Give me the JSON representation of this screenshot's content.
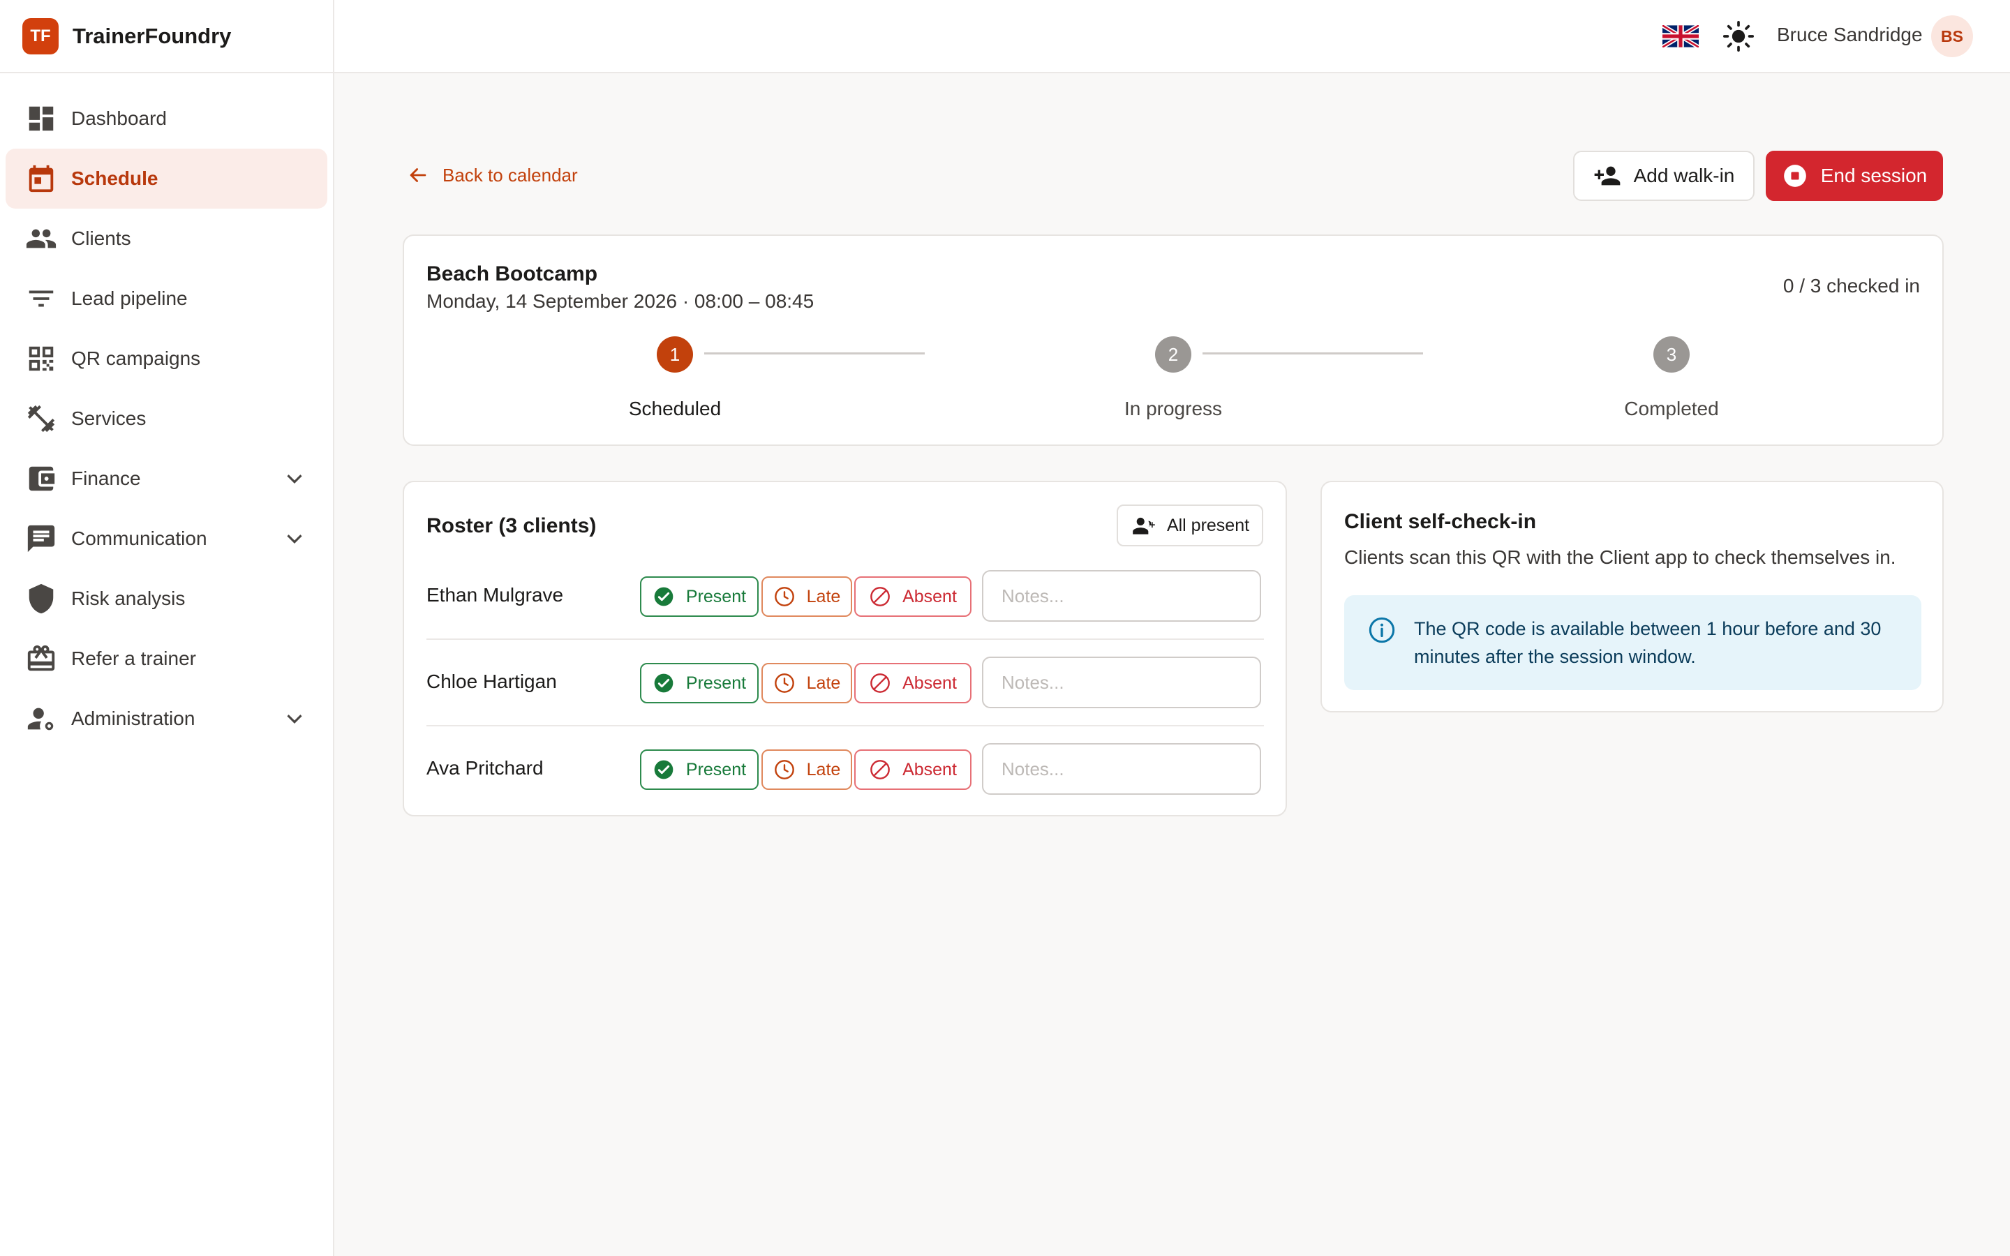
{
  "brand": {
    "logo_text": "TF",
    "name": "TrainerFoundry"
  },
  "sidebar": {
    "items": [
      {
        "label": "Dashboard",
        "icon": "dashboard-icon",
        "active": false,
        "expandable": false
      },
      {
        "label": "Schedule",
        "icon": "calendar-icon",
        "active": true,
        "expandable": false
      },
      {
        "label": "Clients",
        "icon": "people-icon",
        "active": false,
        "expandable": false
      },
      {
        "label": "Lead pipeline",
        "icon": "filter-icon",
        "active": false,
        "expandable": false
      },
      {
        "label": "QR campaigns",
        "icon": "qr-code-icon",
        "active": false,
        "expandable": false
      },
      {
        "label": "Services",
        "icon": "dumbbell-icon",
        "active": false,
        "expandable": false
      },
      {
        "label": "Finance",
        "icon": "wallet-icon",
        "active": false,
        "expandable": true
      },
      {
        "label": "Communication",
        "icon": "chat-icon",
        "active": false,
        "expandable": true
      },
      {
        "label": "Risk analysis",
        "icon": "shield-icon",
        "active": false,
        "expandable": false
      },
      {
        "label": "Refer a trainer",
        "icon": "gift-icon",
        "active": false,
        "expandable": false
      },
      {
        "label": "Administration",
        "icon": "user-settings-icon",
        "active": false,
        "expandable": true
      }
    ]
  },
  "topbar": {
    "language_icon": "uk-flag-icon",
    "theme_icon": "sun-icon",
    "user_name": "Bruce Sandridge",
    "avatar_initials": "BS"
  },
  "header": {
    "back_label": "Back to calendar",
    "add_walkin_label": "Add walk-in",
    "end_session_label": "End session"
  },
  "session": {
    "title": "Beach Bootcamp",
    "subtitle": "Monday, 14 September 2026 · 08:00 – 08:45",
    "checked_in": "0 / 3 checked in",
    "steps": [
      {
        "number": "1",
        "label": "Scheduled",
        "active": true
      },
      {
        "number": "2",
        "label": "In progress",
        "active": false
      },
      {
        "number": "3",
        "label": "Completed",
        "active": false
      }
    ]
  },
  "roster": {
    "title": "Roster (3 clients)",
    "all_present_label": "All present",
    "status_labels": {
      "present": "Present",
      "late": "Late",
      "absent": "Absent"
    },
    "notes_placeholder": "Notes...",
    "clients": [
      {
        "name": "Ethan Mulgrave",
        "notes": ""
      },
      {
        "name": "Chloe Hartigan",
        "notes": ""
      },
      {
        "name": "Ava Pritchard",
        "notes": ""
      }
    ]
  },
  "self_checkin": {
    "title": "Client self-check-in",
    "description": "Clients scan this QR with the Client app to check themselves in.",
    "info": "The QR code is available between 1 hour before and 30 minutes after the session window."
  },
  "colors": {
    "brand": "#d2400d",
    "active_nav_bg": "#fbece8",
    "danger": "#d3262e",
    "present": "#187a3a",
    "late": "#c2410c",
    "absent": "#cc2a33",
    "info_bg": "#e6f4fa"
  }
}
